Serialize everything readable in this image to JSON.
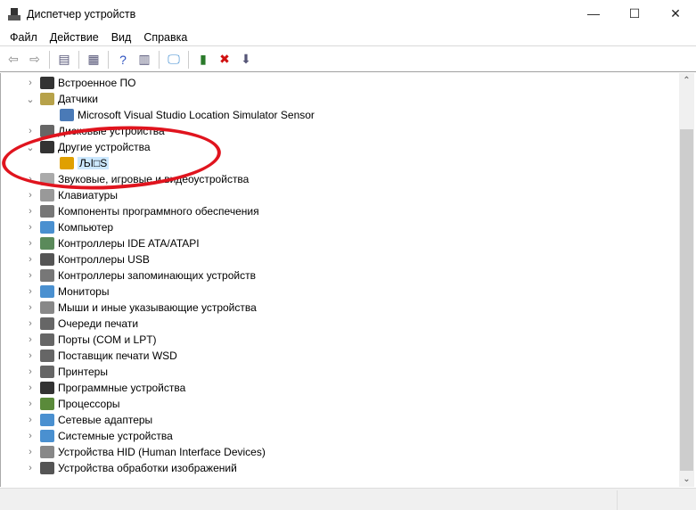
{
  "window": {
    "title": "Диспетчер устройств",
    "minimize": "—",
    "maximize": "☐",
    "close": "✕"
  },
  "menu": [
    "Файл",
    "Действие",
    "Вид",
    "Справка"
  ],
  "toolbar": [
    {
      "name": "back-icon",
      "glyph": "⇦"
    },
    {
      "name": "forward-icon",
      "glyph": "⇨"
    },
    {
      "sep": true
    },
    {
      "name": "show-hide-console-tree-icon",
      "glyph": "▤"
    },
    {
      "sep": true
    },
    {
      "name": "properties-icon",
      "glyph": "▦"
    },
    {
      "sep": true
    },
    {
      "name": "help-icon",
      "glyph": "?"
    },
    {
      "name": "action-pane-icon",
      "glyph": "▥"
    },
    {
      "sep": true
    },
    {
      "name": "scan-hardware-icon",
      "glyph": "🖵"
    },
    {
      "sep": true
    },
    {
      "name": "update-driver-icon",
      "glyph": "▮"
    },
    {
      "name": "uninstall-icon",
      "glyph": "✖"
    },
    {
      "name": "disable-icon",
      "glyph": "⬇"
    }
  ],
  "tree": [
    {
      "label": "Встроенное ПО",
      "level": 0,
      "state": "collapsed",
      "color": "#333"
    },
    {
      "label": "Датчики",
      "level": 0,
      "state": "expanded",
      "color": "#b7a24a"
    },
    {
      "label": "Microsoft Visual Studio Location Simulator Sensor",
      "level": 1,
      "color": "#4a7ab7"
    },
    {
      "label": "Дисковые устройства",
      "level": 0,
      "state": "collapsed",
      "color": "#666"
    },
    {
      "label": "Другие устройства",
      "level": 0,
      "state": "expanded",
      "color": "#333"
    },
    {
      "label": "ЉI□S",
      "level": 1,
      "selected": true,
      "color": "#e0a000"
    },
    {
      "label": "Звуковые, игровые и видеоустройства",
      "level": 0,
      "state": "collapsed",
      "color": "#aaa"
    },
    {
      "label": "Клавиатуры",
      "level": 0,
      "state": "collapsed",
      "color": "#999"
    },
    {
      "label": "Компоненты программного обеспечения",
      "level": 0,
      "state": "collapsed",
      "color": "#777"
    },
    {
      "label": "Компьютер",
      "level": 0,
      "state": "collapsed",
      "color": "#4a90d0"
    },
    {
      "label": "Контроллеры IDE ATA/ATAPI",
      "level": 0,
      "state": "collapsed",
      "color": "#5a8a5a"
    },
    {
      "label": "Контроллеры USB",
      "level": 0,
      "state": "collapsed",
      "color": "#555"
    },
    {
      "label": "Контроллеры запоминающих устройств",
      "level": 0,
      "state": "collapsed",
      "color": "#777"
    },
    {
      "label": "Мониторы",
      "level": 0,
      "state": "collapsed",
      "color": "#4a90d0"
    },
    {
      "label": "Мыши и иные указывающие устройства",
      "level": 0,
      "state": "collapsed",
      "color": "#888"
    },
    {
      "label": "Очереди печати",
      "level": 0,
      "state": "collapsed",
      "color": "#666"
    },
    {
      "label": "Порты (COM и LPT)",
      "level": 0,
      "state": "collapsed",
      "color": "#666"
    },
    {
      "label": "Поставщик печати WSD",
      "level": 0,
      "state": "collapsed",
      "color": "#666"
    },
    {
      "label": "Принтеры",
      "level": 0,
      "state": "collapsed",
      "color": "#666"
    },
    {
      "label": "Программные устройства",
      "level": 0,
      "state": "collapsed",
      "color": "#333"
    },
    {
      "label": "Процессоры",
      "level": 0,
      "state": "collapsed",
      "color": "#5a8a3a"
    },
    {
      "label": "Сетевые адаптеры",
      "level": 0,
      "state": "collapsed",
      "color": "#4a90d0"
    },
    {
      "label": "Системные устройства",
      "level": 0,
      "state": "collapsed",
      "color": "#4a90d0"
    },
    {
      "label": "Устройства HID (Human Interface Devices)",
      "level": 0,
      "state": "collapsed",
      "color": "#888"
    },
    {
      "label": "Устройства обработки изображений",
      "level": 0,
      "state": "collapsed",
      "color": "#555"
    }
  ],
  "scroll": {
    "position_fraction": 0.0,
    "visible_fraction": 0.83
  }
}
